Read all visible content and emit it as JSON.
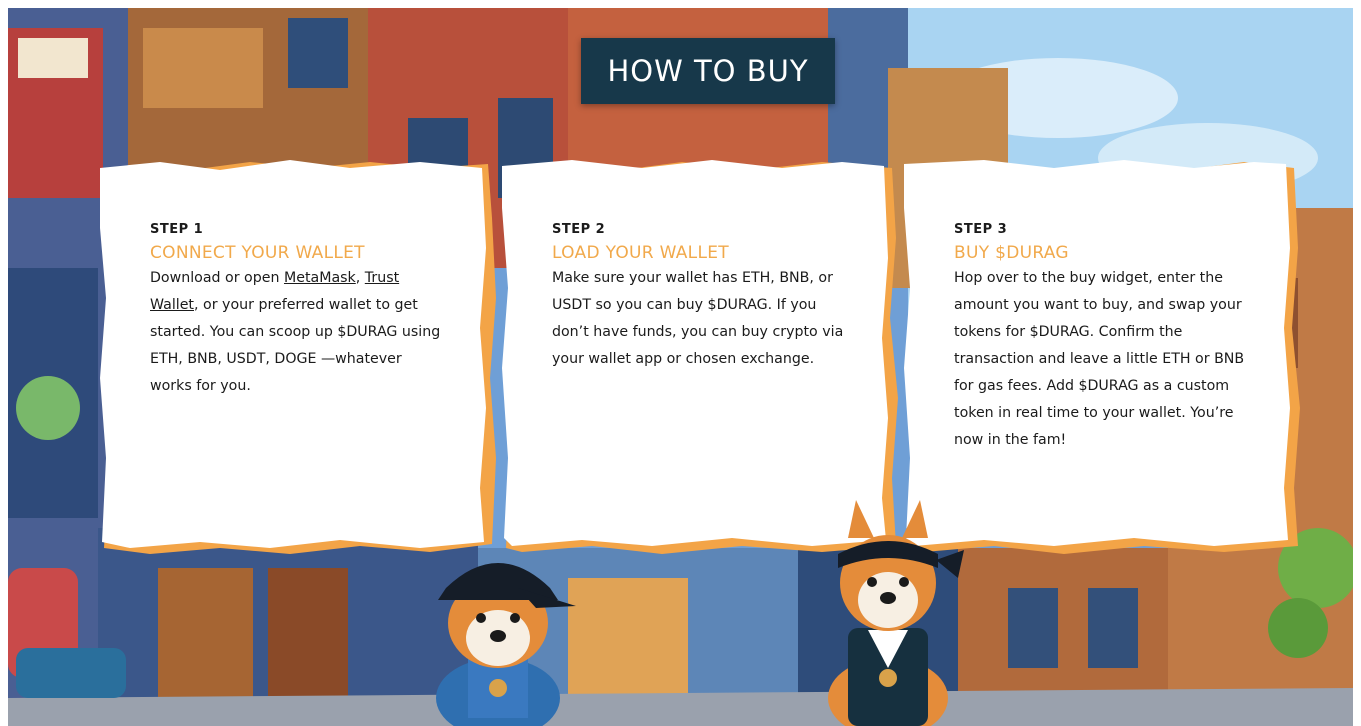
{
  "header": {
    "title": "HOW TO BUY"
  },
  "colors": {
    "banner": "#17384a",
    "accent": "#f1a94b",
    "paper_edge": "#f3a447",
    "text": "#1b1b1b"
  },
  "steps": [
    {
      "label": "STEP 1",
      "title": "CONNECT YOUR WALLET",
      "text_before": "Download or open ",
      "link1": "MetaMask",
      "text_middle": ", ",
      "link2": "Trust Wallet",
      "text_after": ", or your preferred wallet to get started. You can scoop up $DURAG using ETH, BNB, USDT, DOGE —whatever works for you."
    },
    {
      "label": "STEP 2",
      "title": "LOAD YOUR WALLET",
      "body": "Make sure your wallet has ETH, BNB, or USDT so you can buy $DURAG. If you don’t have funds, you can buy crypto via your wallet app or chosen exchange."
    },
    {
      "label": "STEP 3",
      "title": "BUY $DURAG",
      "body": "Hop over to the buy widget, enter the amount you want to buy, and swap your tokens for $DURAG. Confirm the transaction and leave a little ETH or BNB for gas fees. Add $DURAG as a custom token in real time to your wallet. You’re now in the fam!"
    }
  ]
}
